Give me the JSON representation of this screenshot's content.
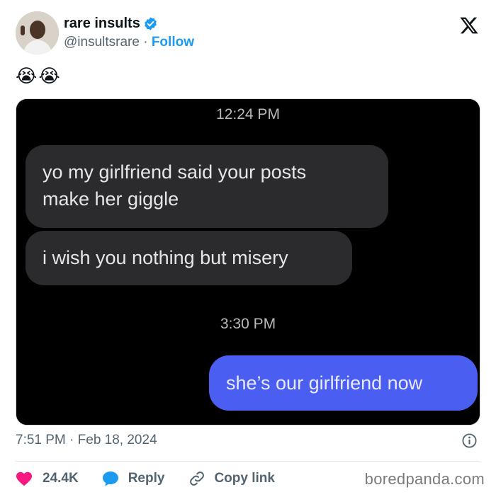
{
  "tweet": {
    "author": {
      "display_name": "rare insults",
      "handle": "@insultsrare",
      "separator": " · ",
      "follow_label": "Follow",
      "verified": true
    },
    "text": "😭😭",
    "media": {
      "messages": [
        {
          "type": "timestamp",
          "text": "12:24 PM"
        },
        {
          "type": "incoming",
          "lines": [
            "yo my girlfriend said your posts",
            "make her giggle"
          ]
        },
        {
          "type": "incoming",
          "lines": [
            "i wish you nothing but misery"
          ]
        },
        {
          "type": "timestamp",
          "text": "3:30 PM"
        },
        {
          "type": "outgoing",
          "lines": [
            "she’s our girlfriend now"
          ]
        }
      ]
    },
    "posted_time": "7:51 PM",
    "posted_separator": " · ",
    "posted_date": "Feb 18, 2024",
    "actions": {
      "likes": "24.4K",
      "reply_label": "Reply",
      "copy_link_label": "Copy link"
    }
  },
  "watermark": "boredpanda.com",
  "colors": {
    "verified_blue": "#1d9bf0",
    "like_pink": "#f91880",
    "outgoing_bubble": "#4a5ff1",
    "incoming_bubble": "#2b2b2d"
  }
}
